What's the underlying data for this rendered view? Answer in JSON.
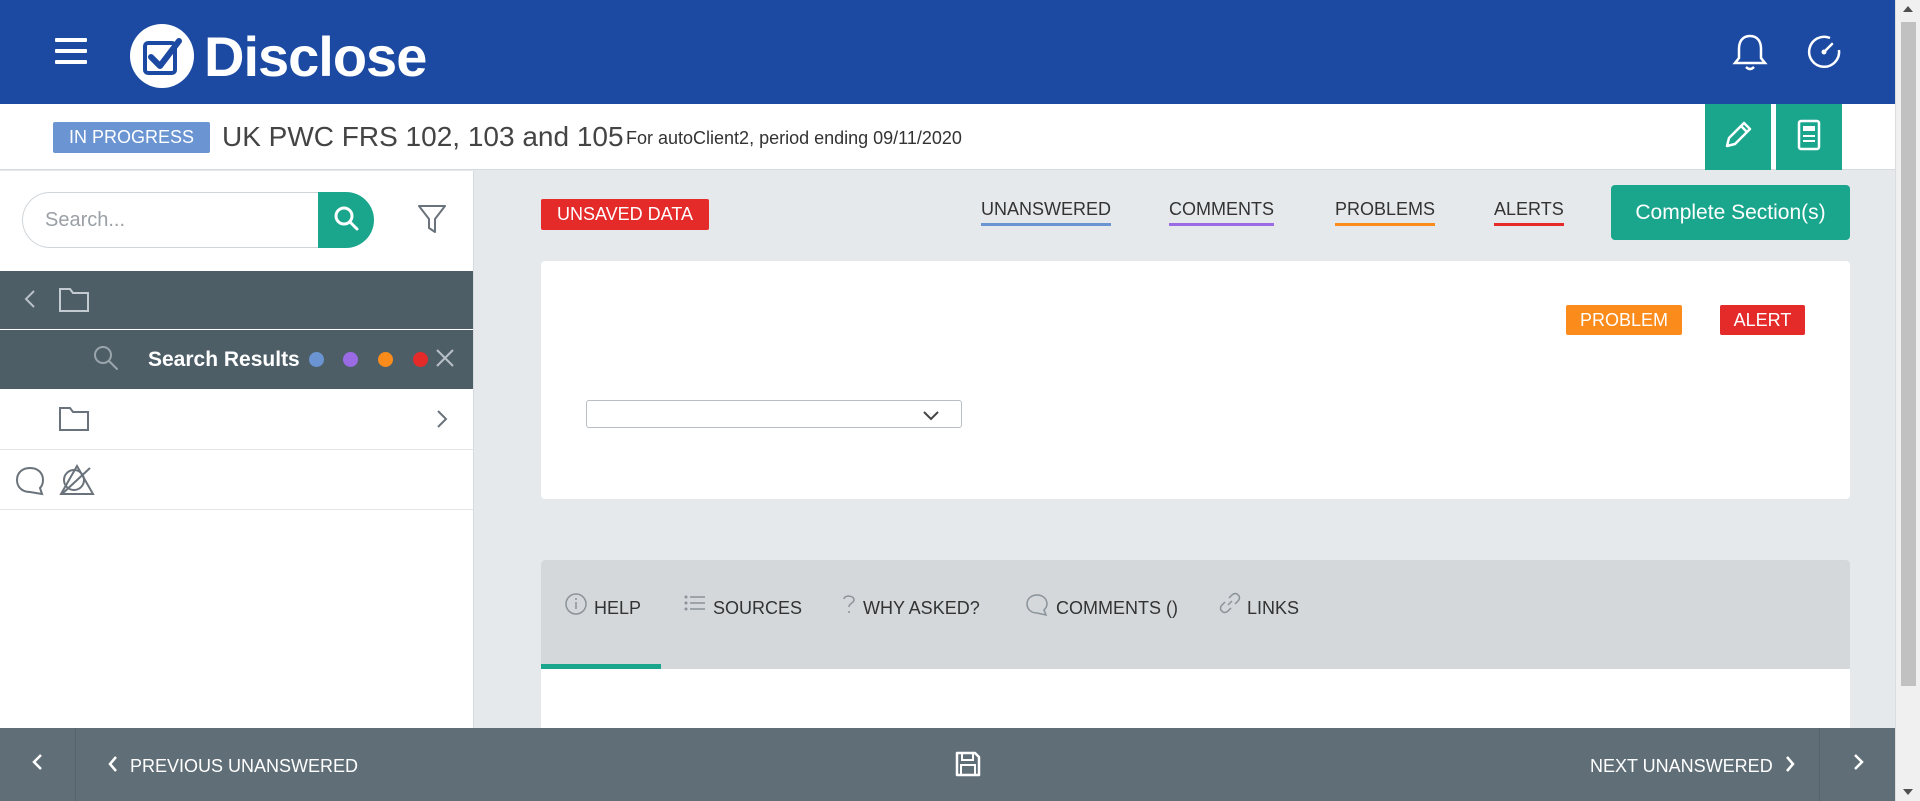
{
  "app": {
    "name": "Disclose"
  },
  "topbar": {
    "menu_icon": "hamburger-icon",
    "bell_icon": "bell-icon",
    "dashboard_icon": "dashboard-icon"
  },
  "header": {
    "status": "IN PROGRESS",
    "title": "UK PWC FRS 102, 103 and 105",
    "subtitle": "For autoClient2, period ending 09/11/2020",
    "edit_icon": "pencil-icon",
    "report_icon": "document-icon"
  },
  "sidebar": {
    "search_placeholder": "Search...",
    "search_results_label": "Search Results",
    "dots": [
      "#6a95d2",
      "#9b6be6",
      "#fb8b1a",
      "#e52a2a"
    ]
  },
  "main": {
    "unsaved_label": "UNSAVED DATA",
    "filters": [
      {
        "label": "UNANSWERED",
        "color": "#6a95d2"
      },
      {
        "label": "COMMENTS",
        "color": "#9b6be6"
      },
      {
        "label": "PROBLEMS",
        "color": "#fb8b1a"
      },
      {
        "label": "ALERTS",
        "color": "#e52a2a"
      }
    ],
    "complete_button": "Complete Section(s)",
    "badges": {
      "problem": "PROBLEM",
      "alert": "ALERT"
    },
    "select_value": ""
  },
  "tabs": [
    {
      "label": "HELP",
      "icon": "info-icon"
    },
    {
      "label": "SOURCES",
      "icon": "list-icon"
    },
    {
      "label": "WHY ASKED?",
      "icon": "question-icon"
    },
    {
      "label": "COMMENTS ()",
      "icon": "comment-icon"
    },
    {
      "label": "LINKS",
      "icon": "link-icon"
    }
  ],
  "bottombar": {
    "previous_label": "PREVIOUS UNANSWERED",
    "next_label": "NEXT UNANSWERED"
  }
}
